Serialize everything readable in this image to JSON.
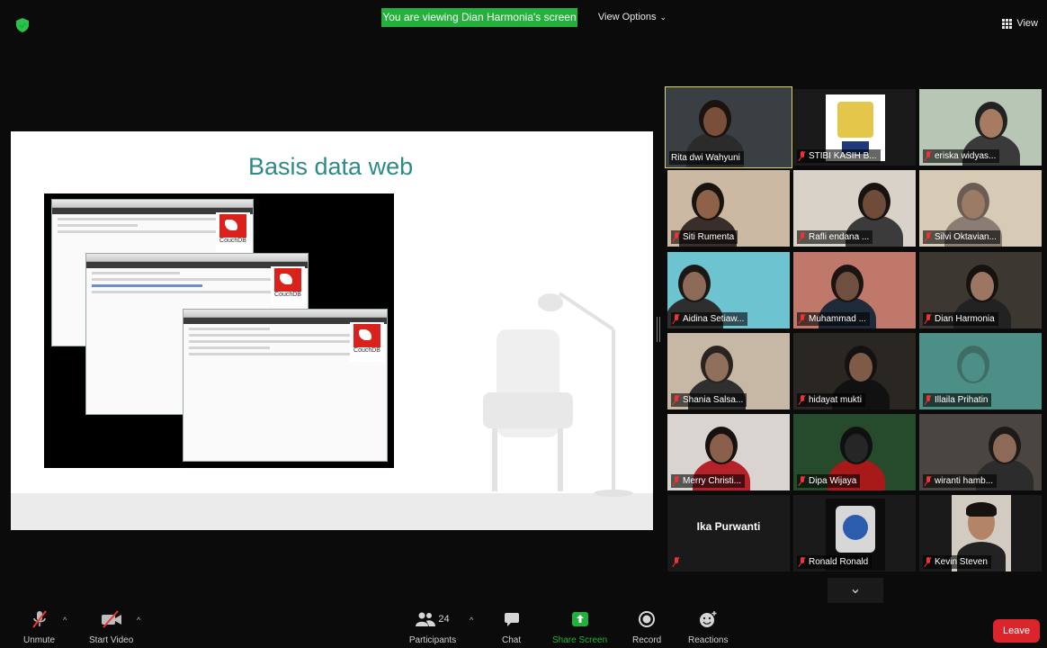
{
  "top_bar": {
    "banner": "You are viewing Dian Harmonia's screen",
    "view_options": "View Options",
    "view": "View"
  },
  "slide": {
    "title": "Basis data web",
    "couchdb_label": "CouchDB"
  },
  "participants": [
    {
      "name": "Rita dwi Wahyuni",
      "muted": false,
      "active": true
    },
    {
      "name": "STIBI KASIH B...",
      "muted": true
    },
    {
      "name": "eriska widyas...",
      "muted": true
    },
    {
      "name": "Siti Rumenta",
      "muted": true
    },
    {
      "name": "Rafli endana ...",
      "muted": true
    },
    {
      "name": "Silvi Oktavian...",
      "muted": true
    },
    {
      "name": "Aidina Setiaw...",
      "muted": true
    },
    {
      "name": "Muhammad ...",
      "muted": true
    },
    {
      "name": "Dian Harmonia",
      "muted": true
    },
    {
      "name": "Shania Salsa...",
      "muted": true
    },
    {
      "name": "hidayat mukti",
      "muted": true
    },
    {
      "name": "Illaila Prihatin",
      "muted": true
    },
    {
      "name": "Merry Christi...",
      "muted": true
    },
    {
      "name": "Dipa Wijaya",
      "muted": true
    },
    {
      "name": "wiranti hamb...",
      "muted": true
    },
    {
      "name": "Ika Purwanti",
      "muted": true,
      "video_off": true
    },
    {
      "name": "Ronald Ronald",
      "muted": true
    },
    {
      "name": "Kevin Steven",
      "muted": true
    }
  ],
  "toolbar": {
    "unmute": "Unmute",
    "start_video": "Start Video",
    "participants": "Participants",
    "participants_count": "24",
    "chat": "Chat",
    "share_screen": "Share Screen",
    "record": "Record",
    "reactions": "Reactions",
    "leave": "Leave"
  },
  "colors": {
    "banner": "#23b13b",
    "slide_title": "#2e8a86",
    "active_outline": "#d9d957",
    "leave": "#d9252b",
    "share_screen": "#23b13b"
  }
}
